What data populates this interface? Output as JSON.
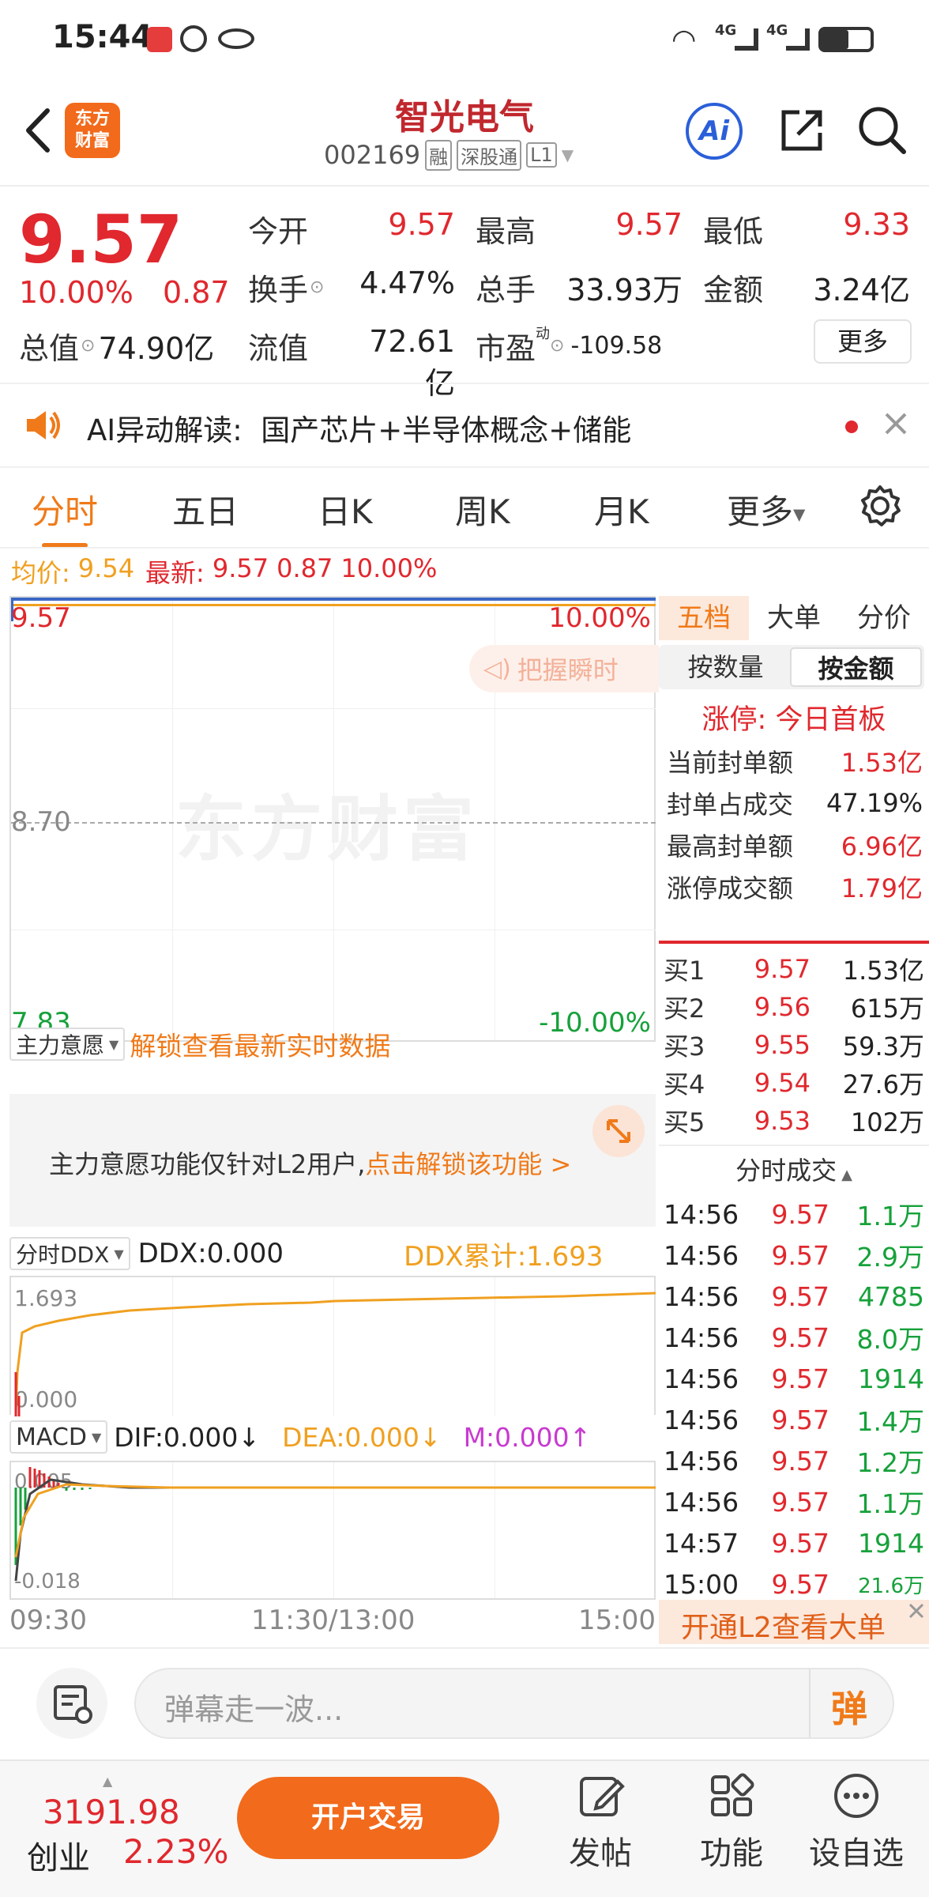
{
  "status_bar": {
    "time": "15:44",
    "network_labels": [
      "4G",
      "4G"
    ]
  },
  "header": {
    "app_logo": "东方\n财富",
    "stock_name": "智光电气",
    "stock_code": "002169",
    "badges": [
      "融",
      "深股通",
      "L1"
    ]
  },
  "quote": {
    "price": "9.57",
    "change_pct": "10.00%",
    "change": "0.87",
    "cols": [
      {
        "label": "今开",
        "value": "9.57",
        "color": "red"
      },
      {
        "label": "最高",
        "value": "9.57",
        "color": "red"
      },
      {
        "label": "最低",
        "value": "9.33",
        "color": "red"
      },
      {
        "label": "换手",
        "value": "4.47%",
        "color": "black"
      },
      {
        "label": "总手",
        "value": "33.93万",
        "color": "black"
      },
      {
        "label": "金额",
        "value": "3.24亿",
        "color": "black"
      }
    ],
    "total_value_label": "总值",
    "total_value": "74.90亿",
    "float_value_label": "流值",
    "float_value": "72.61亿",
    "pe_label": "市盈",
    "pe_sup": "动",
    "pe_value": "-109.58",
    "more_button": "更多"
  },
  "ai_banner": {
    "text": "AI异动解读:  国产芯片+半导体概念+储能"
  },
  "tabs": {
    "items": [
      "分时",
      "五日",
      "日K",
      "周K",
      "月K",
      "更多"
    ],
    "active": "分时"
  },
  "chart_header": {
    "avg_label": "均价:",
    "avg_value": "9.54",
    "latest_label": "最新:",
    "latest_value": "9.57",
    "latest_change": "0.87",
    "latest_pct": "10.00%"
  },
  "chart_labels": {
    "top_price": "9.57",
    "top_pct": "10.00%",
    "mid_price": "8.70",
    "bottom_price": "7.83",
    "bottom_pct": "-10.00%",
    "watermark": "东方财富",
    "grasp_tip": "把握瞬时",
    "time_start": "09:30",
    "time_mid": "11:30/13:00",
    "time_end": "15:00"
  },
  "main_force": {
    "select_label": "主力意愿",
    "unlock_link": "解锁查看最新实时数据",
    "notice_text": "主力意愿功能仅针对L2用户,",
    "notice_link": "点击解锁该功能 >"
  },
  "ddx": {
    "select_label": "分时DDX",
    "ddx_value": "DDX:0.000",
    "ddx_cum": "DDX累计:1.693",
    "axis_top": "1.693",
    "axis_bottom": "0.000"
  },
  "macd": {
    "select_label": "MACD",
    "dif": "DIF:0.000↓",
    "dea": "DEA:0.000↓",
    "m": "M:0.000↑",
    "axis_top": "0.005",
    "axis_bottom": "-0.018"
  },
  "order_book": {
    "tabs": [
      "五档",
      "大单",
      "分价"
    ],
    "sub_tabs": [
      "按数量",
      "按金额"
    ],
    "limit_title": "涨停: 今日首板",
    "stats": [
      {
        "label": "当前封单额",
        "value": "1.53亿",
        "color": "red"
      },
      {
        "label": "封单占成交",
        "value": "47.19%",
        "color": "black"
      },
      {
        "label": "最高封单额",
        "value": "6.96亿",
        "color": "red"
      },
      {
        "label": "涨停成交额",
        "value": "1.79亿",
        "color": "red"
      }
    ],
    "bids": [
      {
        "label": "买1",
        "price": "9.57",
        "vol": "1.53亿"
      },
      {
        "label": "买2",
        "price": "9.56",
        "vol": "615万"
      },
      {
        "label": "买3",
        "price": "9.55",
        "vol": "59.3万"
      },
      {
        "label": "买4",
        "price": "9.54",
        "vol": "27.6万"
      },
      {
        "label": "买5",
        "price": "9.53",
        "vol": "102万"
      }
    ],
    "ticks_title": "分时成交",
    "ticks": [
      {
        "time": "14:56",
        "price": "9.57",
        "vol": "1.1万"
      },
      {
        "time": "14:56",
        "price": "9.57",
        "vol": "2.9万"
      },
      {
        "time": "14:56",
        "price": "9.57",
        "vol": "4785"
      },
      {
        "time": "14:56",
        "price": "9.57",
        "vol": "8.0万"
      },
      {
        "time": "14:56",
        "price": "9.57",
        "vol": "1914"
      },
      {
        "time": "14:56",
        "price": "9.57",
        "vol": "1.4万"
      },
      {
        "time": "14:56",
        "price": "9.57",
        "vol": "1.2万"
      },
      {
        "time": "14:56",
        "price": "9.57",
        "vol": "1.1万"
      },
      {
        "time": "14:57",
        "price": "9.57",
        "vol": "1914"
      },
      {
        "time": "15:00",
        "price": "9.57",
        "vol": "21.6万"
      }
    ],
    "l2_banner": "开通L2查看大单"
  },
  "danmaku": {
    "placeholder": "弹幕走一波...",
    "button": "弹"
  },
  "bottom_bar": {
    "index_value": "3191.98",
    "index_name": "创业",
    "index_pct": "2.23%",
    "trade_button": "开户交易",
    "actions": [
      "发帖",
      "功能",
      "设自选"
    ]
  },
  "colors": {
    "up_red": "#e0282e",
    "down_green": "#16a13a",
    "accent_orange": "#f07a19",
    "avg_line": "#f0a020",
    "price_line": "#3a66c4"
  }
}
